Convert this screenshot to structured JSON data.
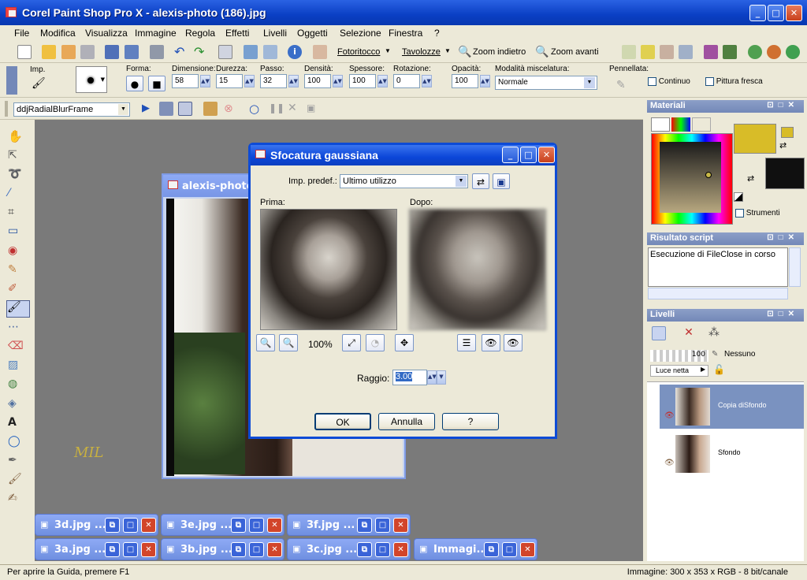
{
  "window": {
    "title": "Corel Paint Shop Pro X - alexis-photo (186).jpg"
  },
  "menu": [
    "File",
    "Modifica",
    "Visualizza",
    "Immagine",
    "Regola",
    "Effetti",
    "Livelli",
    "Oggetti",
    "Selezione",
    "Finestra",
    "?"
  ],
  "toolbar": {
    "fotoritocco": "Fotoritocco",
    "tavolozze": "Tavolozze",
    "zoom_out": "Zoom indietro",
    "zoom_in": "Zoom avanti"
  },
  "tool_options": {
    "imp_label": "Imp.",
    "forma": "Forma:",
    "dimensione": {
      "label": "Dimensione:",
      "value": "58"
    },
    "durezza": {
      "label": "Durezza:",
      "value": "15"
    },
    "passo": {
      "label": "Passo:",
      "value": "32"
    },
    "densita": {
      "label": "Densità:",
      "value": "100"
    },
    "spessore": {
      "label": "Spessore:",
      "value": "100"
    },
    "rotazione": {
      "label": "Rotazione:",
      "value": "0"
    },
    "opacita": {
      "label": "Opacità:",
      "value": "100"
    },
    "modalita": {
      "label": "Modalità miscelatura:",
      "value": "Normale"
    },
    "pennellata": "Pennellata:",
    "continuo": "Continuo",
    "pittura_fresca": "Pittura fresca"
  },
  "script_bar": {
    "selected": "ddjRadialBlurFrame"
  },
  "document": {
    "title": "alexis-photo ("
  },
  "watermark": "MIL",
  "dialog": {
    "title": "Sfocatura gaussiana",
    "preset_label": "Imp. predef.:",
    "preset_value": "Ultimo utilizzo",
    "before_label": "Prima:",
    "after_label": "Dopo:",
    "zoom": "100%",
    "radius_label": "Raggio:",
    "radius_value": "3.00",
    "ok": "OK",
    "cancel": "Annulla",
    "help": "?"
  },
  "panels": {
    "materials": {
      "title": "Materiali",
      "strumenti": "Strumenti"
    },
    "script_result": {
      "title": "Risultato script",
      "text": "Esecuzione di FileClose in corso"
    },
    "layers": {
      "title": "Livelli",
      "opacity": "100",
      "mask": "Nessuno",
      "blend": "Luce netta",
      "items": [
        {
          "name": "Copia diSfondo"
        },
        {
          "name": "Sfondo"
        }
      ]
    }
  },
  "taskbar_windows": [
    {
      "label": "3d.jpg ..."
    },
    {
      "label": "3e.jpg ..."
    },
    {
      "label": "3f.jpg ..."
    },
    {
      "label": "3a.jpg ..."
    },
    {
      "label": "3b.jpg ..."
    },
    {
      "label": "3c.jpg ..."
    },
    {
      "label": "Immagi..."
    }
  ],
  "status": {
    "left": "Per aprire la Guida, premere F1",
    "right": "Immagine:  300 x 353 x RGB - 8 bit/canale"
  },
  "colors": {
    "foreground": "#d8bc28",
    "background": "#101010",
    "titlebar": "#0a3fc4"
  }
}
